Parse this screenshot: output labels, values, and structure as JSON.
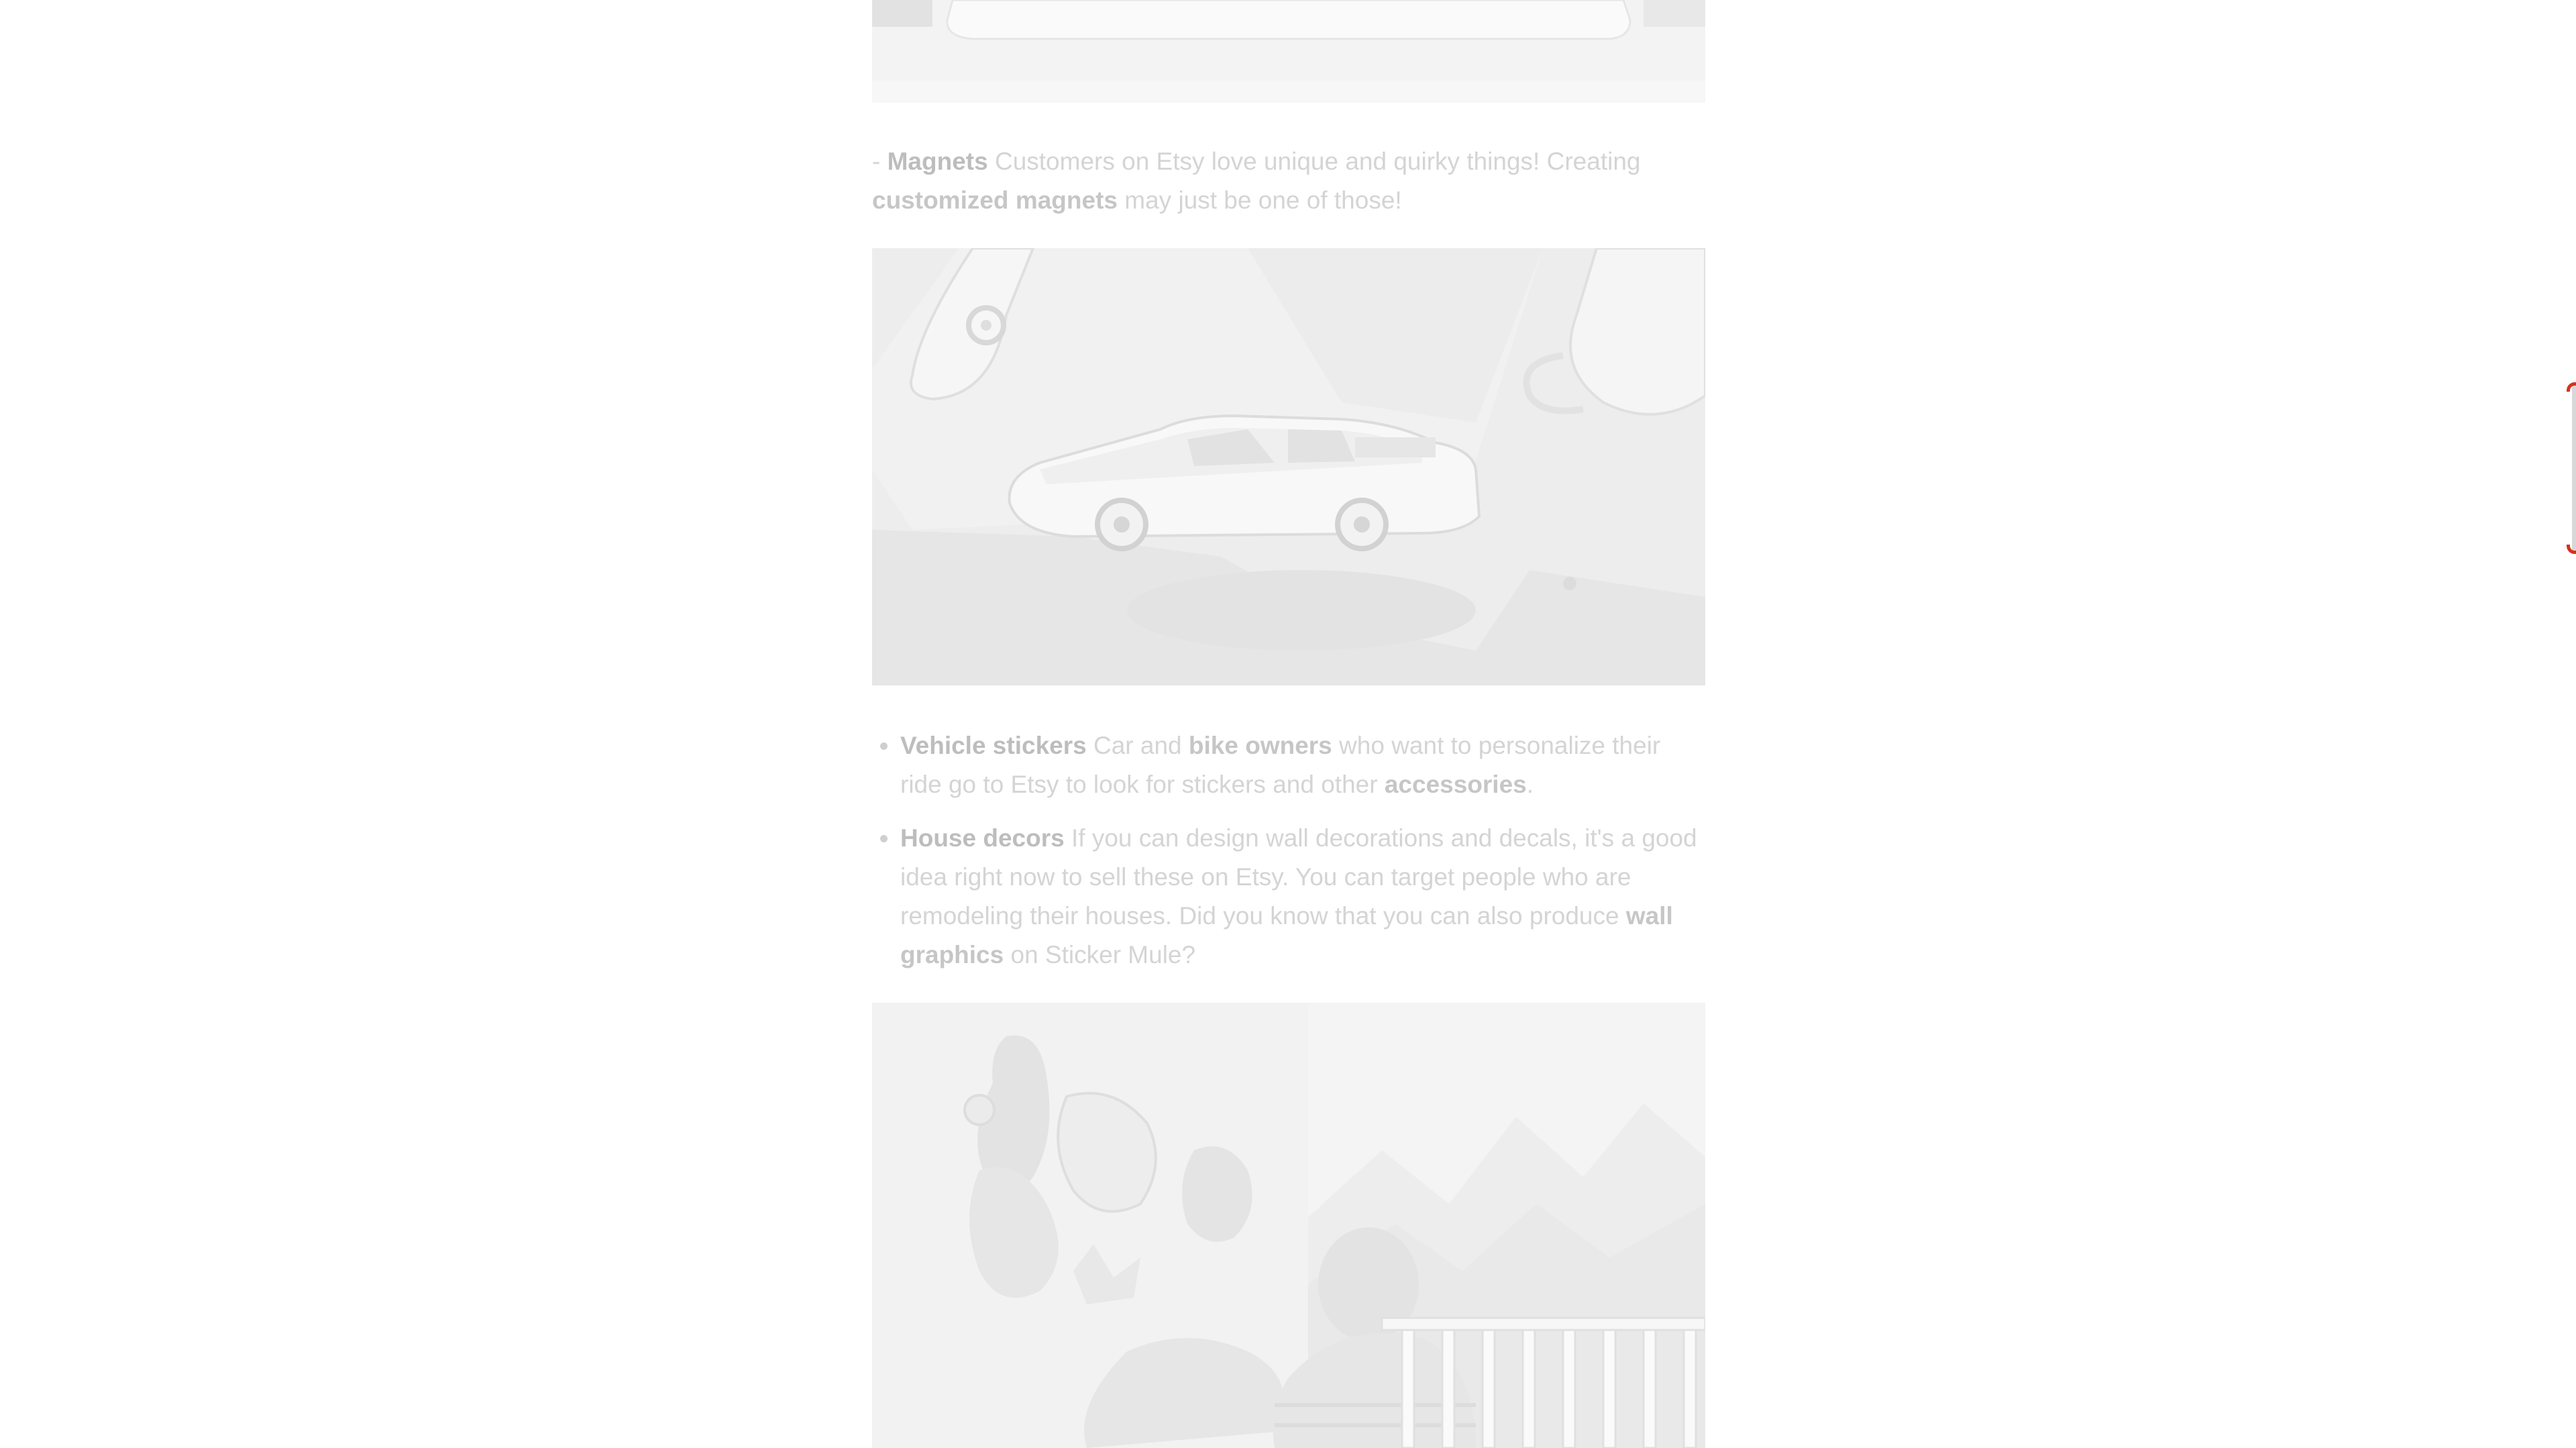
{
  "magnets": {
    "prefix": "- ",
    "title": "Magnets",
    "text1": " Customers on Etsy love unique and quirky things! Creating ",
    "link": "customized magnets",
    "text2": " may just be one of those!"
  },
  "bullets": [
    {
      "title": "Vehicle stickers",
      "text1": " Car and ",
      "link1": "bike owners",
      "text2": " who want to personalize their ride go to Etsy to look for stickers and other ",
      "link2": "accessories",
      "text3": "."
    },
    {
      "title": "House decors",
      "text1": " If you can design wall decorations and decals, it's a good idea right now to sell these on Etsy. You can target people who are remodeling their houses. Did you know that you can also produce ",
      "link1": "wall graphics",
      "text2": " on Sticker Mule?"
    }
  ],
  "colors": {
    "text": "#d4d4d4",
    "bold": "#bdbdbd",
    "scroll_accent": "#d8301c"
  }
}
